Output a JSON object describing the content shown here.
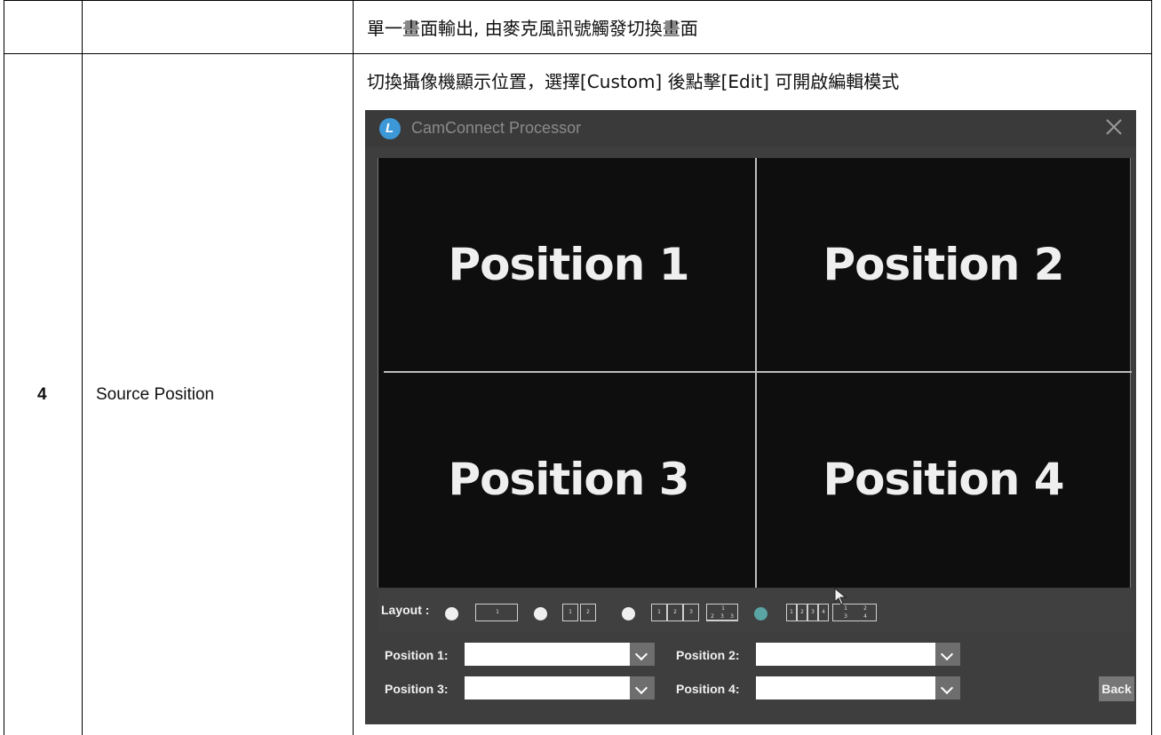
{
  "table": {
    "row1": {
      "description": "單一畫面輸出, 由麥克風訊號觸發切換畫面"
    },
    "row2": {
      "number": "4",
      "item": "Source Position",
      "description": "切換攝像機顯示位置，選擇[Custom]  後點擊[Edit]  可開啟編輯模式"
    }
  },
  "app": {
    "title": "CamConnect Processor",
    "positions": [
      "Position 1",
      "Position 2",
      "Position 3",
      "Position 4"
    ],
    "layout_label": "Layout :",
    "selected_layout_index": 3,
    "layout_options": [
      {
        "thumbs": [
          "1"
        ]
      },
      {
        "thumbs": [
          "1",
          "2"
        ]
      },
      {
        "thumbs": [
          "1",
          "2",
          "3"
        ],
        "alt": "1 / 2 3"
      },
      {
        "thumbs": [
          "1",
          "2",
          "3",
          "4"
        ],
        "alt": "1 2 / 3 4"
      }
    ],
    "form": {
      "position1_label": "Position 1:",
      "position2_label": "Position 2:",
      "position3_label": "Position 3:",
      "position4_label": "Position 4:",
      "position1_value": "",
      "position2_value": "",
      "position3_value": "",
      "position4_value": ""
    },
    "back_label": "Back"
  },
  "colors": {
    "window_bg": "#3e3e3e",
    "preview_bg": "#0e0e0e",
    "selected_radio": "#5aa4a4",
    "logo": "#3d98d8"
  },
  "icons": [
    "app-logo-icon",
    "close-icon",
    "chevron-down-icon",
    "mouse-cursor-icon"
  ]
}
